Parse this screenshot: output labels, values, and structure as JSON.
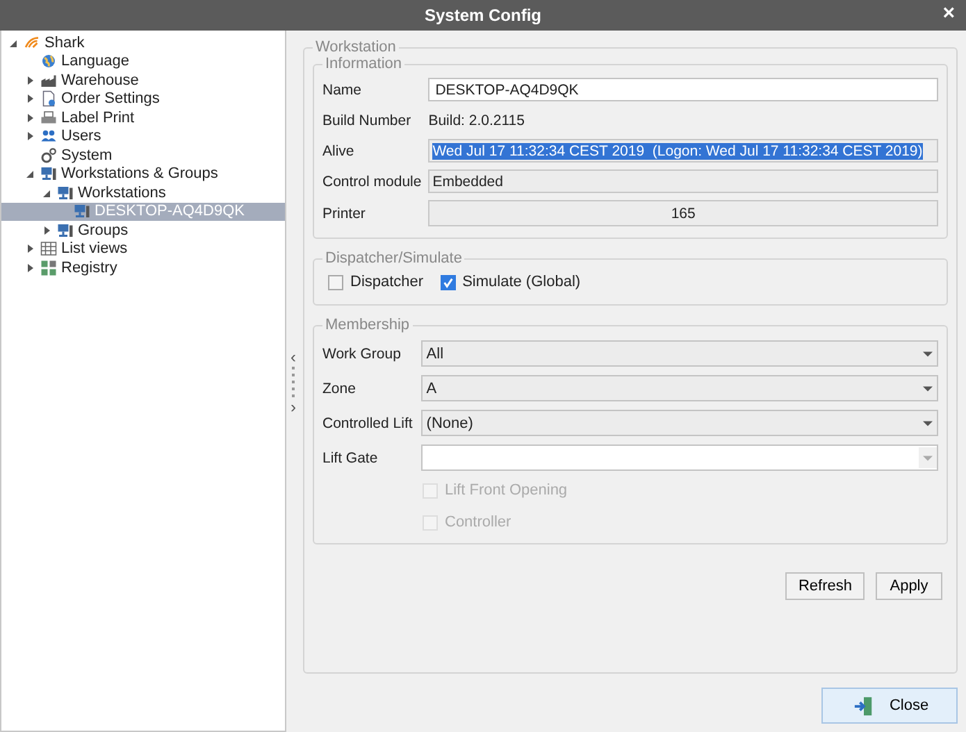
{
  "window": {
    "title": "System Config",
    "close": "×"
  },
  "tree": [
    {
      "label": "Shark",
      "expanded": true,
      "selected": false,
      "children": [
        {
          "label": "Language",
          "selected": false
        },
        {
          "label": "Warehouse",
          "expanded": false,
          "selected": false
        },
        {
          "label": "Order Settings",
          "expanded": false,
          "selected": false
        },
        {
          "label": "Label Print",
          "expanded": false,
          "selected": false
        },
        {
          "label": "Users",
          "expanded": false,
          "selected": false
        },
        {
          "label": "System",
          "selected": false
        },
        {
          "label": "Workstations & Groups",
          "expanded": true,
          "selected": false,
          "children": [
            {
              "label": "Workstations",
              "expanded": true,
              "selected": false,
              "children": [
                {
                  "label": "DESKTOP-AQ4D9QK",
                  "selected": true
                }
              ]
            },
            {
              "label": "Groups",
              "expanded": false,
              "selected": false
            }
          ]
        },
        {
          "label": "List views",
          "expanded": false,
          "selected": false
        },
        {
          "label": "Registry",
          "expanded": false,
          "selected": false
        }
      ]
    }
  ],
  "splitter": {
    "left": "‹",
    "right": "›"
  },
  "workstation": {
    "title": "Workstation",
    "information": {
      "title": "Information",
      "fields": [
        {
          "label": "Name",
          "kind": "input",
          "value": "DESKTOP-AQ4D9QK"
        },
        {
          "label": "Build Number",
          "kind": "text",
          "value": "Build: 2.0.2115"
        },
        {
          "label": "Alive",
          "kind": "readonly",
          "value": "Wed Jul 17 11:32:34 CEST 2019  (Logon: Wed Jul 17 11:32:34 CEST 2019)",
          "highlighted": true
        },
        {
          "label": "Control module",
          "kind": "readonly",
          "value": "Embedded",
          "highlighted": false
        },
        {
          "label": "Printer",
          "kind": "number",
          "value": "165"
        }
      ]
    },
    "dispatcher": {
      "title": "Dispatcher/Simulate",
      "checks": [
        {
          "label": "Dispatcher",
          "checked": false
        },
        {
          "label": "Simulate (Global)",
          "checked": true
        }
      ]
    },
    "membership": {
      "title": "Membership",
      "dropdowns": [
        {
          "label": "Work Group",
          "value": "All",
          "editable": false
        },
        {
          "label": "Zone",
          "value": "A",
          "editable": false
        },
        {
          "label": "Controlled Lift",
          "value": "(None)",
          "editable": false
        },
        {
          "label": "Lift Gate",
          "editable": true
        }
      ],
      "checks": [
        {
          "label": "Lift Front Opening",
          "checked": false,
          "disabled": true
        },
        {
          "label": "Controller",
          "checked": false,
          "disabled": true
        }
      ]
    },
    "buttons": [
      "Refresh",
      "Apply"
    ]
  },
  "close_button": "Close"
}
